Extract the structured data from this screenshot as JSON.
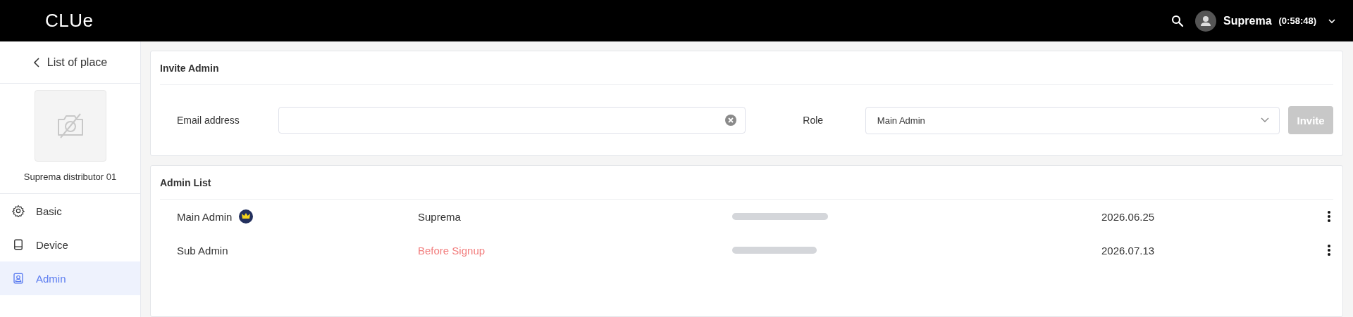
{
  "header": {
    "logo": "CLUe",
    "user_name": "Suprema",
    "session_time": "(0:58:48)"
  },
  "sidebar": {
    "back_label": "List of place",
    "place_name": "Suprema distributor 01",
    "items": [
      {
        "label": "Basic",
        "kind": "gear",
        "selected": false
      },
      {
        "label": "Device",
        "kind": "tablet",
        "selected": false
      },
      {
        "label": "Admin",
        "kind": "person",
        "selected": true
      }
    ]
  },
  "invite": {
    "title": "Invite Admin",
    "email_label": "Email address",
    "role_label": "Role",
    "role_value": "Main Admin",
    "button": "Invite",
    "button_disabled": true
  },
  "admin_list": {
    "title": "Admin List",
    "rows": [
      {
        "role": "Main Admin",
        "crown": true,
        "name": "Suprema",
        "name_pending": false,
        "date": "2026.06.25"
      },
      {
        "role": "Sub Admin",
        "crown": false,
        "name": "Before Signup",
        "name_pending": true,
        "date": "2026.07.13"
      }
    ]
  }
}
